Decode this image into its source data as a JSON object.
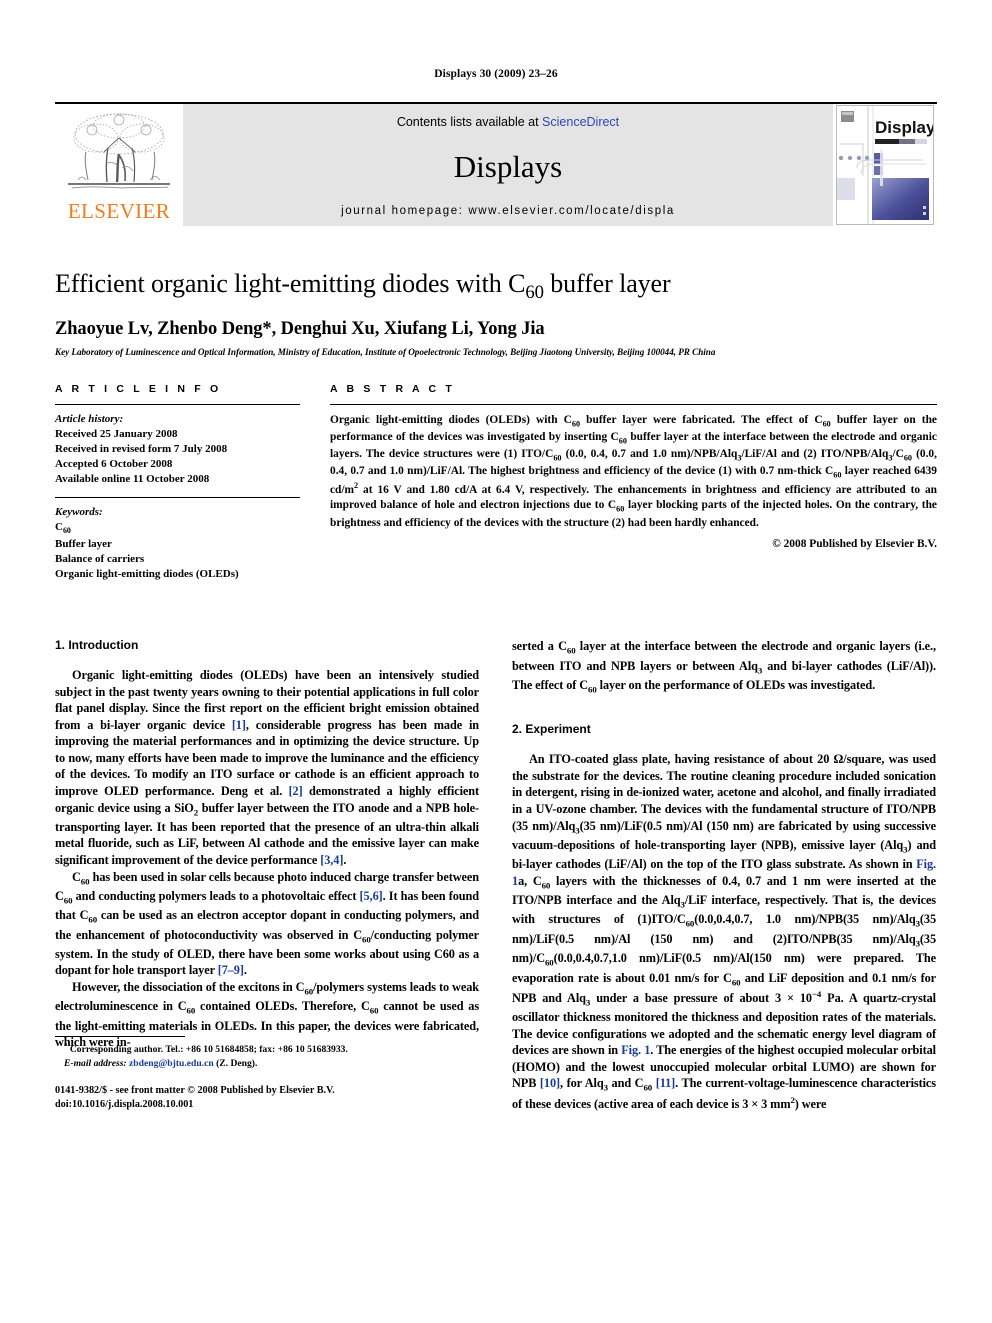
{
  "running_head": "Displays 30 (2009) 23–26",
  "masthead": {
    "publisher_name": "ELSEVIER",
    "contents_prefix": "Contents lists available at ",
    "contents_link": "ScienceDirect",
    "journal_name": "Displays",
    "homepage": "journal homepage: www.elsevier.com/locate/displa",
    "cover_title": "Displays"
  },
  "article": {
    "title_part1": "Efficient organic light-emitting diodes with C",
    "title_sub": "60",
    "title_part2": " buffer layer",
    "authors": "Zhaoyue Lv, Zhenbo Deng*, Denghui Xu, Xiufang Li, Yong Jia",
    "affiliation": "Key Laboratory of Luminescence and Optical Information, Ministry of Education, Institute of Opoelectronic Technology, Beijing Jiaotong University, Beijing 100044, PR China"
  },
  "article_info": {
    "heading": "A R T I C L E   I N F O",
    "history_label": "Article history:",
    "history": [
      "Received 25 January 2008",
      "Received in revised form 7 July 2008",
      "Accepted 6 October 2008",
      "Available online 11 October 2008"
    ],
    "keywords_label": "Keywords:",
    "keywords": [
      "C60",
      "Buffer layer",
      "Balance of carriers",
      "Organic light-emitting diodes (OLEDs)"
    ]
  },
  "abstract": {
    "heading": "A B S T R A C T",
    "text": "Organic light-emitting diodes (OLEDs) with C60 buffer layer were fabricated. The effect of C60 buffer layer on the performance of the devices was investigated by inserting C60 buffer layer at the interface between the electrode and organic layers. The device structures were (1) ITO/C60 (0.0, 0.4, 0.7 and 1.0 nm)/NPB/Alq3/LiF/Al and (2) ITO/NPB/Alq3/C60 (0.0, 0.4, 0.7 and 1.0 nm)/LiF/Al. The highest brightness and efficiency of the device (1) with 0.7 nm-thick C60 layer reached 6439 cd/m2 at 16 V and 1.80 cd/A at 6.4 V, respectively. The enhancements in brightness and efficiency are attributed to an improved balance of hole and electron injections due to C60 layer blocking parts of the injected holes. On the contrary, the brightness and efficiency of the devices with the structure (2) had been hardly enhanced.",
    "copyright": "© 2008 Published by Elsevier B.V."
  },
  "sections": {
    "intro_heading": "1. Introduction",
    "intro_p1": "Organic light-emitting diodes (OLEDs) have been an intensively studied subject in the past twenty years owning to their potential applications in full color flat panel display. Since the first report on the efficient bright emission obtained from a bi-layer organic device [1], considerable progress has been made in improving the material performances and in optimizing the device structure. Up to now, many efforts have been made to improve the luminance and the efficiency of the devices. To modify an ITO surface or cathode is an efficient approach to improve OLED performance. Deng et al. [2] demonstrated a highly efficient organic device using a SiO2 buffer layer between the ITO anode and a NPB hole-transporting layer. It has been reported that the presence of an ultra-thin alkali metal fluoride, such as LiF, between Al cathode and the emissive layer can make significant improvement of the device performance [3,4].",
    "intro_p2": "C60 has been used in solar cells because photo induced charge transfer between C60 and conducting polymers leads to a photovoltaic effect [5,6]. It has been found that C60 can be used as an electron acceptor dopant in conducting polymers, and the enhancement of photoconductivity was observed in C60/conducting polymer system. In the study of OLED, there have been some works about using C60 as a dopant for hole transport layer [7–9].",
    "intro_p3": "However, the dissociation of the excitons in C60/polymers systems leads to weak electroluminescence in C60 contained OLEDs. Therefore, C60 cannot be used as the light-emitting materials in OLEDs. In this paper, the devices were fabricated, which were inserted a C60 layer at the interface between the electrode and organic layers (i.e., between ITO and NPB layers or between Alq3 and bi-layer cathodes (LiF/Al)). The effect of C60 layer on the performance of OLEDs was investigated.",
    "experiment_heading": "2. Experiment",
    "experiment_p1": "An ITO-coated glass plate, having resistance of about 20 Ω/square, was used the substrate for the devices. The routine cleaning procedure included sonication in detergent, rising in de-ionized water, acetone and alcohol, and finally irradiated in a UV-ozone chamber. The devices with the fundamental structure of ITO/NPB (35 nm)/Alq3(35 nm)/LiF(0.5 nm)/Al (150 nm) are fabricated by using successive vacuum-depositions of hole-transporting layer (NPB), emissive layer (Alq3) and bi-layer cathodes (LiF/Al) on the top of the ITO glass substrate. As shown in Fig. 1a, C60 layers with the thicknesses of 0.4, 0.7 and 1 nm were inserted at the ITO/NPB interface and the Alq3/LiF interface, respectively. That is, the devices with structures of (1)ITO/C60(0.0,0.4,0.7, 1.0 nm)/NPB(35 nm)/Alq3(35 nm)/LiF(0.5 nm)/Al (150 nm) and (2)ITO/NPB(35 nm)/Alq3(35 nm)/C60(0.0,0.4,0.7,1.0 nm)/LiF(0.5 nm)/Al(150 nm) were prepared. The evaporation rate is about 0.01 nm/s for C60 and LiF deposition and 0.1 nm/s for NPB and Alq3 under a base pressure of about 3 × 10−4 Pa. A quartz-crystal oscillator thickness monitored the thickness and deposition rates of the materials. The device configurations we adopted and the schematic energy level diagram of devices are shown in Fig. 1. The energies of the highest occupied molecular orbital (HOMO) and the lowest unoccupied molecular orbital LUMO) are shown for NPB [10], for Alq3 and C60 [11]. The current-voltage-luminescence characteristics of these devices (active area of each device is 3 × 3 mm2) were"
  },
  "footnotes": {
    "corresponding": "Corresponding author. Tel.: +86 10 51684858; fax: +86 10 51683933.",
    "email_label": "E-mail address:",
    "email": "zbdeng@bjtu.edu.cn",
    "email_suffix": " (Z. Deng).",
    "issn_line": "0141-9382/$ - see front matter © 2008 Published by Elsevier B.V.",
    "doi_line": "doi:10.1016/j.displa.2008.10.001"
  },
  "colors": {
    "link_blue": "#2b49b5",
    "ref_blue": "#1a3a96",
    "elsevier_orange": "#F07C19",
    "masthead_gray": "#e4e4e4"
  }
}
